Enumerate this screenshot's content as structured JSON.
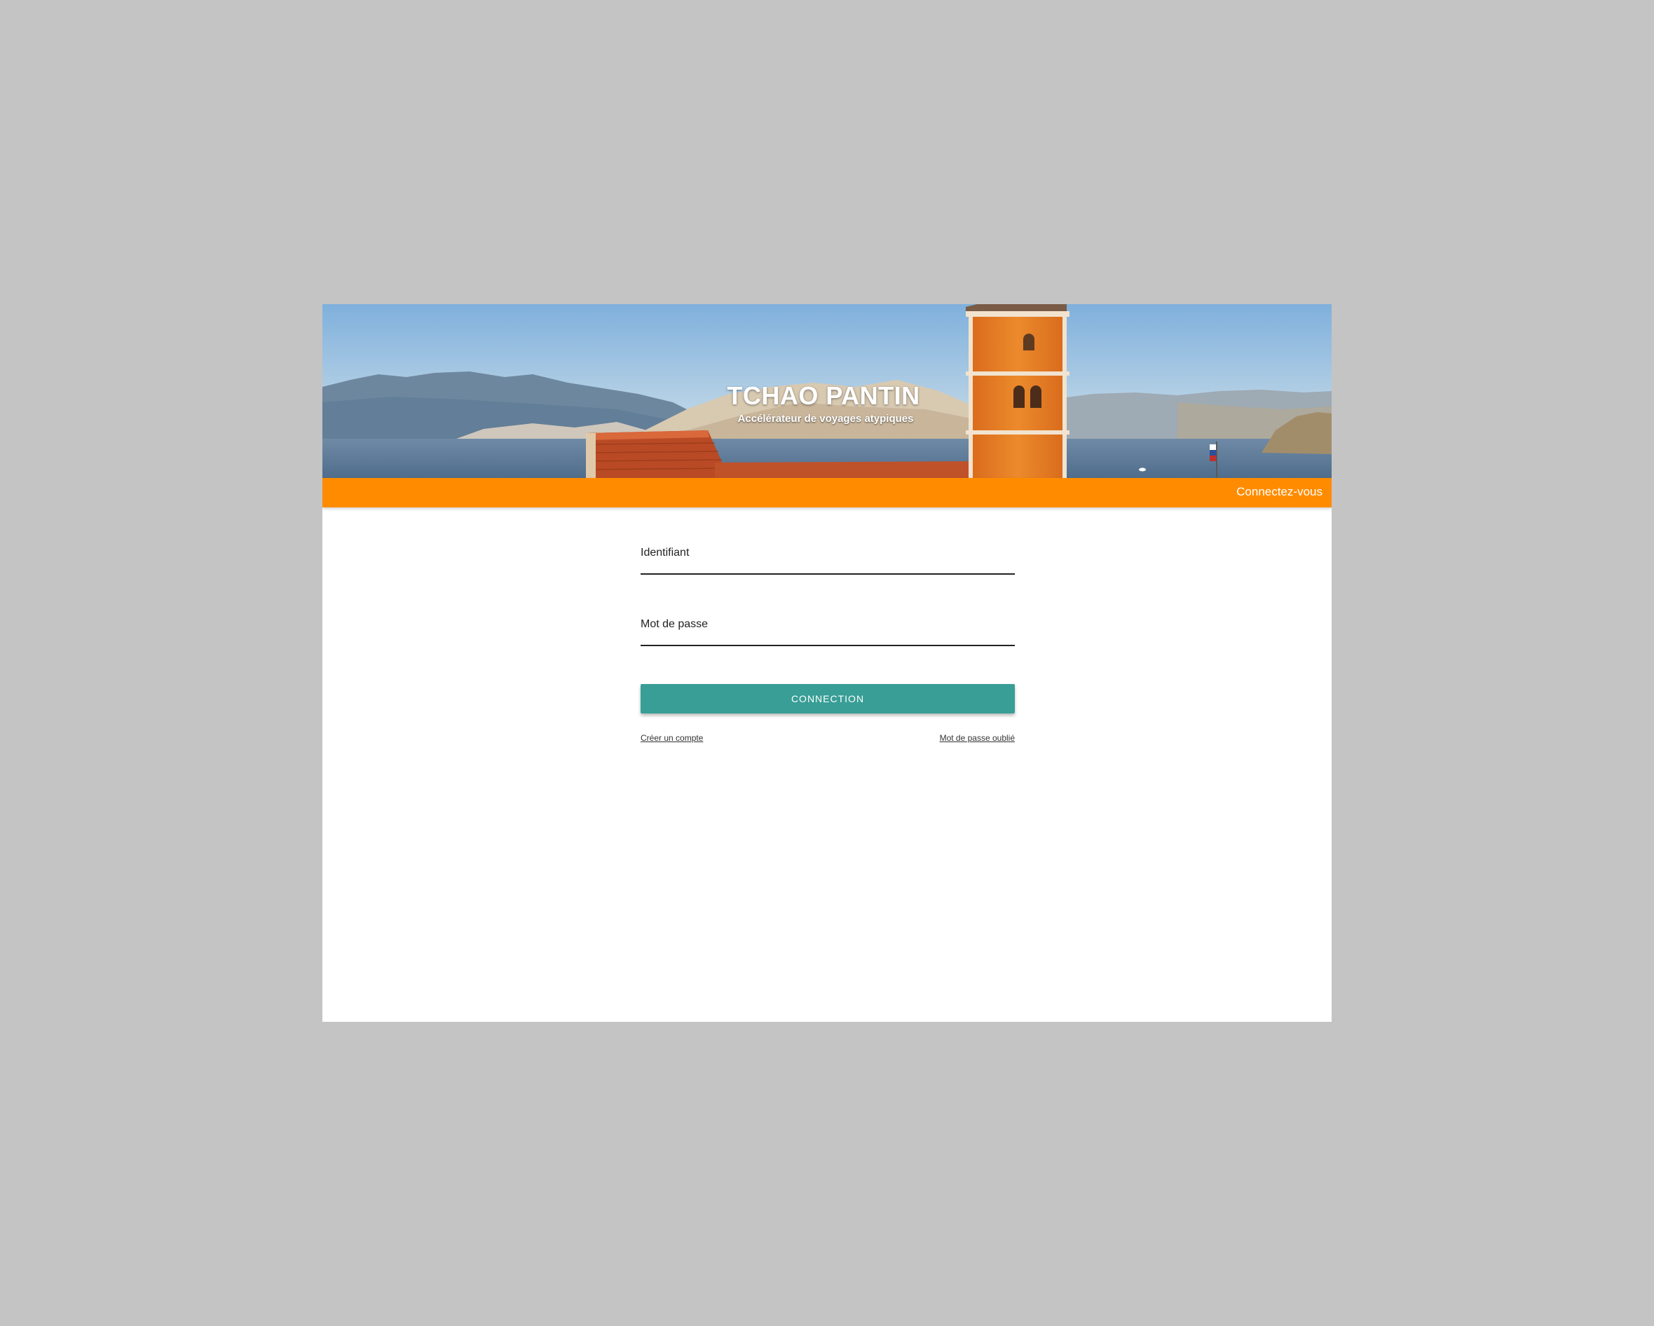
{
  "header": {
    "title": "TCHAO PANTIN",
    "subtitle": "Accélérateur de voyages atypiques"
  },
  "nav": {
    "login_link": "Connectez-vous"
  },
  "login_form": {
    "username_label": "Identifiant",
    "password_label": "Mot de passe",
    "submit_label": "CONNECTION",
    "create_account_link": "Créer un compte",
    "forgot_password_link": "Mot de passe oublié"
  },
  "colors": {
    "page_background": "#c4c4c4",
    "nav_bar": "#ff8c00",
    "submit_button": "#389e96"
  }
}
